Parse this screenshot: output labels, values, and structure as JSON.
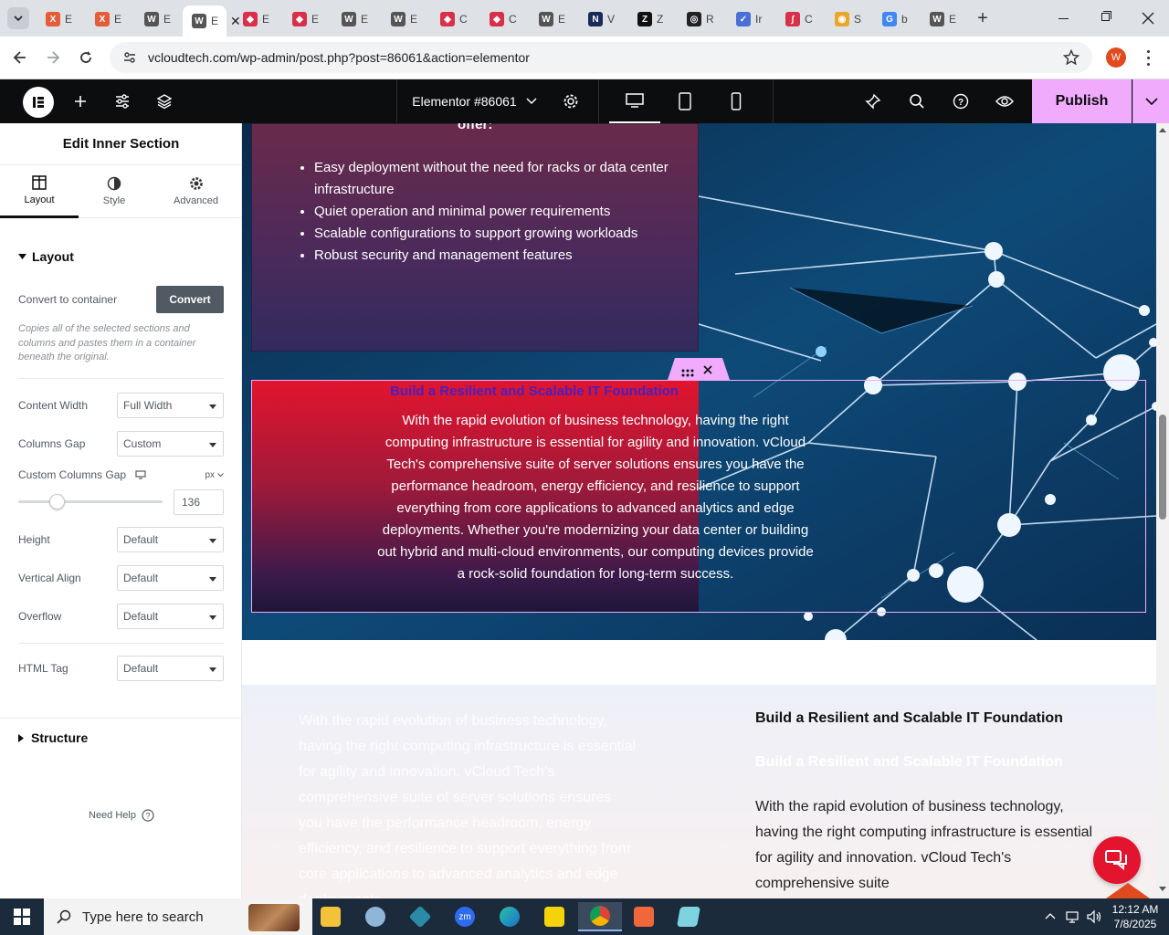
{
  "browser": {
    "tabs": [
      {
        "letter": "E",
        "color": "#e55c3a",
        "glyph": "X"
      },
      {
        "letter": "E",
        "color": "#e55c3a",
        "glyph": "X"
      },
      {
        "letter": "E",
        "color": "#555",
        "glyph": "W"
      },
      {
        "letter": "E",
        "color": "#555",
        "glyph": "W",
        "active": true
      },
      {
        "letter": "E",
        "color": "#d9304a",
        "glyph": "◆"
      },
      {
        "letter": "E",
        "color": "#d9304a",
        "glyph": "◆"
      },
      {
        "letter": "E",
        "color": "#555",
        "glyph": "W"
      },
      {
        "letter": "E",
        "color": "#555",
        "glyph": "W"
      },
      {
        "letter": "C",
        "color": "#d9304a",
        "glyph": "◆"
      },
      {
        "letter": "C",
        "color": "#d9304a",
        "glyph": "◆"
      },
      {
        "letter": "E",
        "color": "#555",
        "glyph": "W"
      },
      {
        "letter": "V",
        "color": "#1a2a5a",
        "glyph": "N"
      },
      {
        "letter": "Z",
        "color": "#111",
        "glyph": "Z"
      },
      {
        "letter": "R",
        "color": "#222",
        "glyph": "◎"
      },
      {
        "letter": "Ir",
        "color": "#4a6fd6",
        "glyph": "✓"
      },
      {
        "letter": "C",
        "color": "#d9304a",
        "glyph": "∫"
      },
      {
        "letter": "S",
        "color": "#e8a62a",
        "glyph": "◉"
      },
      {
        "letter": "b",
        "color": "#4285f4",
        "glyph": "G"
      },
      {
        "letter": "E",
        "color": "#555",
        "glyph": "W"
      }
    ],
    "new_tab": "+",
    "url": "vcloudtech.com/wp-admin/post.php?post=86061&action=elementor",
    "profile_initial": "W",
    "colors": {
      "profile": "#e04a1f"
    }
  },
  "elementor": {
    "doc_title": "Elementor #86061",
    "publish_label": "Publish",
    "panel": {
      "title": "Edit Inner Section",
      "tabs": [
        "Layout",
        "Style",
        "Advanced"
      ],
      "section_layout": "Layout",
      "convert_label": "Convert to container",
      "convert_button": "Convert",
      "convert_help": "Copies all of the selected sections and columns and pastes them in a container beneath the original.",
      "content_width_label": "Content Width",
      "content_width_value": "Full Width",
      "columns_gap_label": "Columns Gap",
      "columns_gap_value": "Custom",
      "custom_gap_label": "Custom Columns Gap",
      "custom_gap_unit": "px",
      "custom_gap_value": "136",
      "height_label": "Height",
      "height_value": "Default",
      "valign_label": "Vertical Align",
      "valign_value": "Default",
      "overflow_label": "Overflow",
      "overflow_value": "Default",
      "html_tag_label": "HTML Tag",
      "html_tag_value": "Default",
      "structure_label": "Structure",
      "need_help": "Need Help"
    }
  },
  "page": {
    "box1_heading_fragment": "offer:",
    "bullets": [
      "Easy deployment without the need for racks or data center infrastructure",
      "Quiet operation and minimal power requirements",
      "Scalable configurations to support growing workloads",
      "Robust security and management features"
    ],
    "heading": "Build a Resilient and Scalable IT Foundation",
    "paragraph": "With the rapid evolution of business technology, having the right computing infrastructure is essential for agility and innovation. vCloud Tech's comprehensive suite of server solutions ensures you have the performance headroom, energy efficiency, and resilience to support everything from core applications to advanced analytics and edge deployments. Whether you're modernizing your data center or building out hybrid and multi-cloud environments, our computing devices provide a rock-solid foundation for long-term success.",
    "lower_left_text": "With the rapid evolution of business technology, having the right computing infrastructure is essential for agility and innovation. vCloud Tech's comprehensive suite of server solutions ensures you have the performance headroom, energy efficiency, and resilience to support everything from core applications to advanced analytics and edge deployments.",
    "lower_right_heading": "Build a Resilient and Scalable IT Foundation",
    "lower_right_heading_faded": "Build a Resilient and Scalable IT Foundation",
    "lower_right_text": "With the rapid evolution of business technology, having the right computing infrastructure is essential for agility and innovation. vCloud Tech's comprehensive suite"
  },
  "taskbar": {
    "search_placeholder": "Type here to search",
    "time": "12:12 AM",
    "date": "7/8/2025"
  }
}
